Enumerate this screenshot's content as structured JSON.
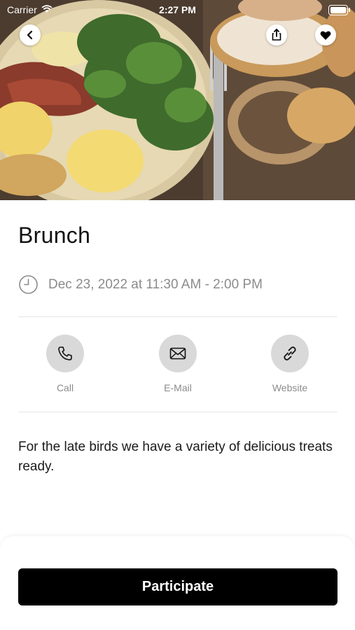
{
  "status_bar": {
    "carrier": "Carrier",
    "time": "2:27 PM",
    "icons": [
      "wifi-icon",
      "battery-icon"
    ]
  },
  "hero": {
    "icons": [
      "back-icon",
      "share-icon",
      "heart-icon"
    ]
  },
  "event": {
    "title": "Brunch",
    "datetime": "Dec 23, 2022 at 11:30 AM - 2:00 PM",
    "datetime_icon": "clock-icon",
    "description": "For the late birds we have a variety of delicious treats ready."
  },
  "actions": [
    {
      "label": "Call",
      "icon": "phone-icon"
    },
    {
      "label": "E-Mail",
      "icon": "envelope-icon"
    },
    {
      "label": "Website",
      "icon": "link-icon"
    }
  ],
  "cta": {
    "label": "Participate"
  },
  "colors": {
    "accent": "#000000",
    "muted_text": "#8b8b8b",
    "action_circle": "#d9d9d9"
  }
}
